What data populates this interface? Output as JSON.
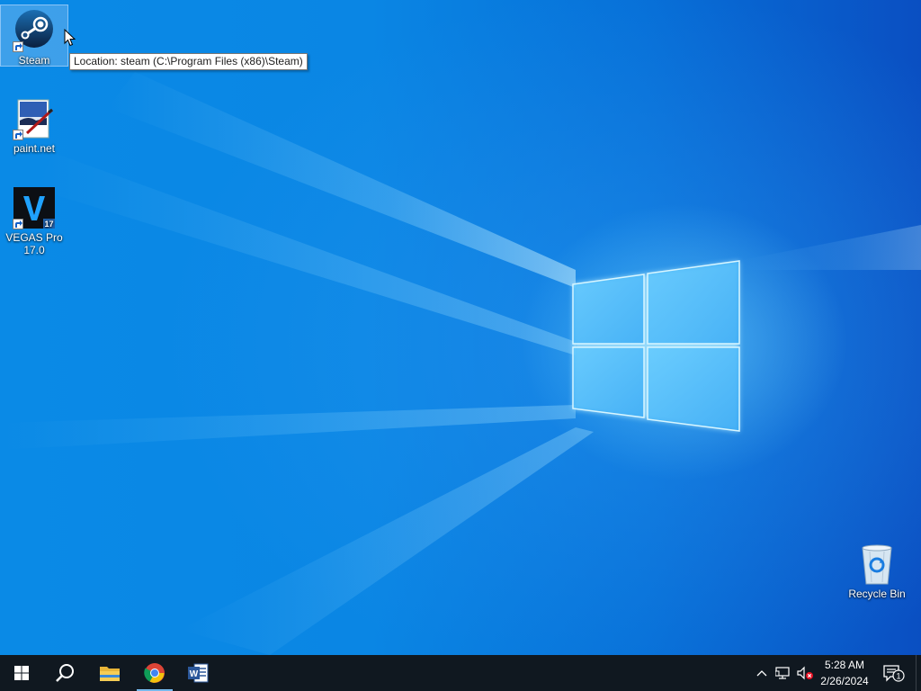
{
  "desktop": {
    "icons": [
      {
        "label": "Steam",
        "icon": "steam-icon"
      },
      {
        "label": "paint.net",
        "icon": "paintnet-icon"
      },
      {
        "label": "VEGAS Pro 17.0",
        "icon": "vegas-pro-icon",
        "badge": "17"
      },
      {
        "label": "Recycle Bin",
        "icon": "recycle-bin-icon"
      }
    ],
    "tooltip": "Location: steam (C:\\Program Files (x86)\\Steam)"
  },
  "taskbar": {
    "buttons": [
      {
        "name": "start",
        "icon": "windows-icon"
      },
      {
        "name": "search",
        "icon": "search-icon"
      },
      {
        "name": "file-explorer",
        "icon": "folder-icon"
      },
      {
        "name": "chrome",
        "icon": "chrome-icon"
      },
      {
        "name": "word",
        "icon": "word-icon"
      }
    ],
    "tray": {
      "time": "5:28 AM",
      "date": "2/26/2024",
      "notification_count": "1"
    }
  },
  "colors": {
    "taskbar_bg": "#101820",
    "active_indicator": "#76b9ed",
    "wallpaper_blue": "#0a86e4"
  }
}
